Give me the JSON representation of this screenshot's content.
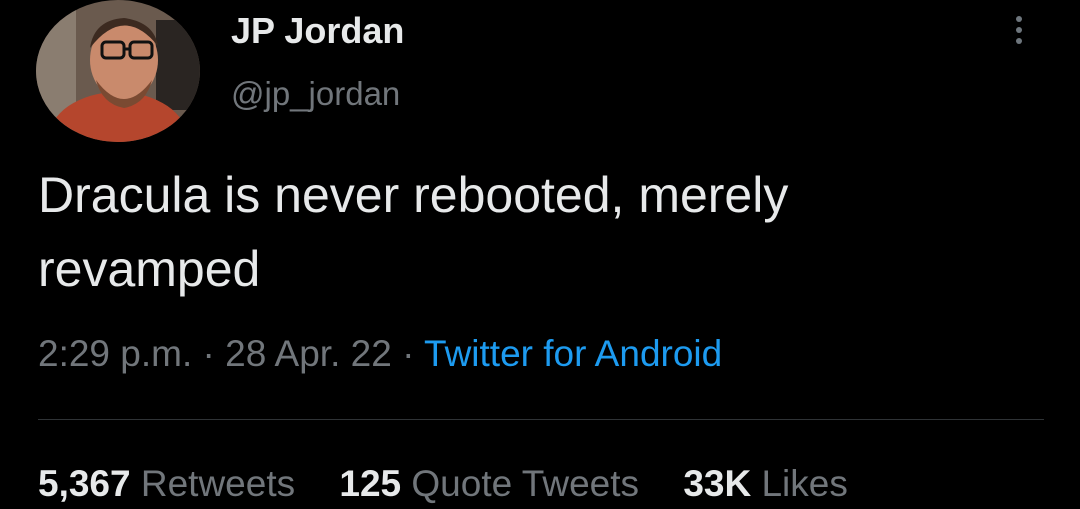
{
  "author": {
    "name": "JP Jordan",
    "handle": "@jp_jordan"
  },
  "icons": {
    "avatar": "profile-photo",
    "more": "more-vertical-icon"
  },
  "tweet": {
    "text": "Dracula is never rebooted, merely\nrevamped",
    "time": "2:29 p.m.",
    "separator": " · ",
    "date": "28 Apr. 22",
    "source": "Twitter for Android"
  },
  "stats": {
    "retweets_count": "5,367",
    "retweets_label": "Retweets",
    "quotes_count": "125",
    "quotes_label": "Quote Tweets",
    "likes_count": "33K",
    "likes_label": "Likes"
  },
  "colors": {
    "background": "#000000",
    "text": "#e7e9ea",
    "muted": "#71767b",
    "link": "#1d9bf0",
    "divider": "#2f3336"
  }
}
